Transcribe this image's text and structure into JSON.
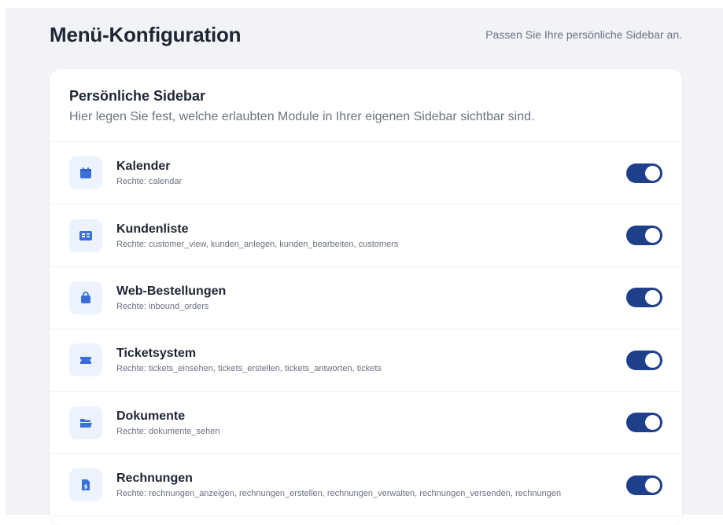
{
  "header": {
    "title": "Menü-Konfiguration",
    "subtitle": "Passen Sie Ihre persönliche Sidebar an."
  },
  "card": {
    "title": "Persönliche Sidebar",
    "description": "Hier legen Sie fest, welche erlaubten Module in Ihrer eigenen Sidebar sichtbar sind."
  },
  "accent_color": "#3b6fd8",
  "toggle_on_color": "#1e3f8a",
  "modules": [
    {
      "icon": "calendar-icon",
      "title": "Kalender",
      "rights": "Rechte: calendar",
      "enabled": true
    },
    {
      "icon": "id-card-icon",
      "title": "Kundenliste",
      "rights": "Rechte: customer_view, kunden_anlegen, kunden_bearbeiten, customers",
      "enabled": true
    },
    {
      "icon": "shopping-bag-icon",
      "title": "Web-Bestellungen",
      "rights": "Rechte: inbound_orders",
      "enabled": true
    },
    {
      "icon": "ticket-icon",
      "title": "Ticketsystem",
      "rights": "Rechte: tickets_einsehen, tickets_erstellen, tickets_antworten, tickets",
      "enabled": true
    },
    {
      "icon": "folder-open-icon",
      "title": "Dokumente",
      "rights": "Rechte: dokumente_sehen",
      "enabled": true
    },
    {
      "icon": "invoice-icon",
      "title": "Rechnungen",
      "rights": "Rechte: rechnungen_anzeigen, rechnungen_erstellen, rechnungen_verwalten, rechnungen_versenden, rechnungen",
      "enabled": true
    }
  ]
}
